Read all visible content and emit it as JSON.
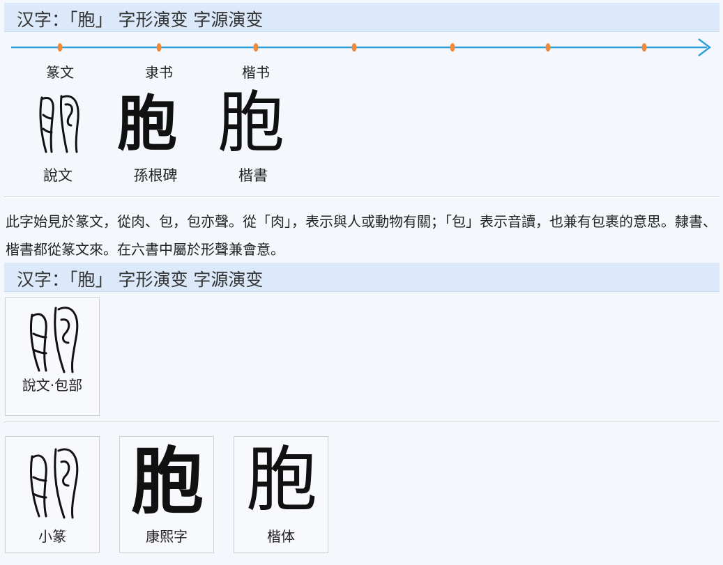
{
  "header1": {
    "title": "汉字：「胞」 字形演变 字源演变"
  },
  "timeline": {
    "eras": [
      "篆文",
      "隶书",
      "楷书"
    ]
  },
  "evolution": [
    {
      "glyph": "",
      "caption": "說文"
    },
    {
      "glyph": "胞",
      "caption": "孫根碑"
    },
    {
      "glyph": "胞",
      "caption": "楷書"
    }
  ],
  "description": "此字始見於篆文，從肉、包，包亦聲。從「肉」，表示與人或動物有關；「包」表示音讀，也兼有包裹的意思。隸書、楷書都從篆文來。在六書中屬於形聲兼會意。",
  "header2": {
    "title": "汉字：「胞」 字形演变 字源演变"
  },
  "shuowen": {
    "caption": "說文·包部"
  },
  "variants": [
    {
      "glyph": "",
      "caption": "小篆"
    },
    {
      "glyph": "胞",
      "caption": "康熙字"
    },
    {
      "glyph": "胞",
      "caption": "楷体"
    }
  ],
  "colors": {
    "accent": "#2a9fd8",
    "marker": "#f08a3c",
    "header_bg": "#dbe9fa"
  }
}
